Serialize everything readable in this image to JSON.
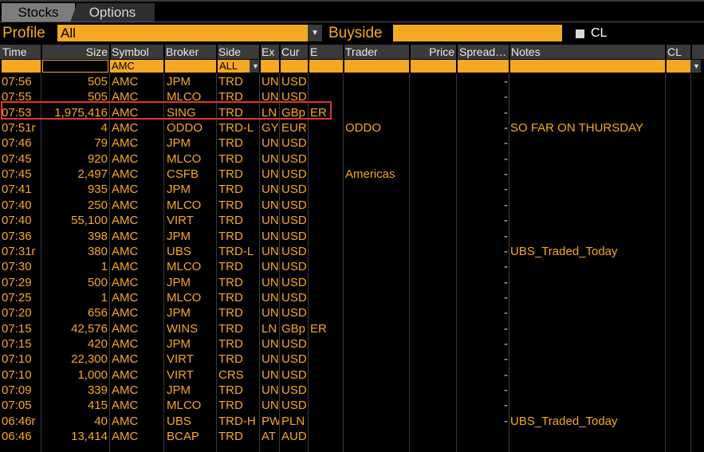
{
  "tabs": [
    {
      "label": "Stocks",
      "active": true
    },
    {
      "label": "Options",
      "active": false
    }
  ],
  "profile": {
    "label": "Profile",
    "value": "All",
    "buyside_label": "Buyside",
    "buyside_value": "",
    "cl_label": "CL",
    "cl_checked": false
  },
  "columns": [
    "Time",
    "Size",
    "Symbol",
    "Broker",
    "Side",
    "Ex",
    "Cur",
    "E",
    "Trader",
    "Price",
    "Spread…",
    "Notes",
    "CL"
  ],
  "filters": {
    "size": "",
    "symbol": "AMC",
    "side": "ALL"
  },
  "colors": {
    "accent": "#f7a823",
    "highlight": "#e0362c",
    "header_bg": "#3a3a3a"
  },
  "rows": [
    {
      "time": "07:56",
      "size": "505",
      "symbol": "AMC",
      "broker": "JPM",
      "side": "TRD",
      "ex": "UN",
      "cur": "USD",
      "e": "",
      "trader": "",
      "spread": "-",
      "notes": ""
    },
    {
      "time": "07:55",
      "size": "505",
      "symbol": "AMC",
      "broker": "MLCO",
      "side": "TRD",
      "ex": "UN",
      "cur": "USD",
      "e": "",
      "trader": "",
      "spread": "-",
      "notes": ""
    },
    {
      "time": "07:53",
      "size": "1,975,416",
      "symbol": "AMC",
      "broker": "SING",
      "side": "TRD",
      "ex": "LN",
      "cur": "GBp",
      "e": "ER",
      "trader": "",
      "spread": "-",
      "notes": ""
    },
    {
      "time": "07:51r",
      "size": "4",
      "symbol": "AMC",
      "broker": "ODDO",
      "side": "TRD-L",
      "ex": "GY",
      "cur": "EUR",
      "e": "",
      "trader": "ODDO",
      "spread": "-",
      "notes": "SO FAR ON THURSDAY"
    },
    {
      "time": "07:46",
      "size": "79",
      "symbol": "AMC",
      "broker": "JPM",
      "side": "TRD",
      "ex": "UN",
      "cur": "USD",
      "e": "",
      "trader": "",
      "spread": "-",
      "notes": ""
    },
    {
      "time": "07:45",
      "size": "920",
      "symbol": "AMC",
      "broker": "MLCO",
      "side": "TRD",
      "ex": "UN",
      "cur": "USD",
      "e": "",
      "trader": "",
      "spread": "-",
      "notes": ""
    },
    {
      "time": "07:45",
      "size": "2,497",
      "symbol": "AMC",
      "broker": "CSFB",
      "side": "TRD",
      "ex": "UN",
      "cur": "USD",
      "e": "",
      "trader": "Americas",
      "spread": "-",
      "notes": ""
    },
    {
      "time": "07:41",
      "size": "935",
      "symbol": "AMC",
      "broker": "JPM",
      "side": "TRD",
      "ex": "UN",
      "cur": "USD",
      "e": "",
      "trader": "",
      "spread": "-",
      "notes": ""
    },
    {
      "time": "07:40",
      "size": "250",
      "symbol": "AMC",
      "broker": "MLCO",
      "side": "TRD",
      "ex": "UN",
      "cur": "USD",
      "e": "",
      "trader": "",
      "spread": "-",
      "notes": ""
    },
    {
      "time": "07:40",
      "size": "55,100",
      "symbol": "AMC",
      "broker": "VIRT",
      "side": "TRD",
      "ex": "UN",
      "cur": "USD",
      "e": "",
      "trader": "",
      "spread": "-",
      "notes": ""
    },
    {
      "time": "07:36",
      "size": "398",
      "symbol": "AMC",
      "broker": "JPM",
      "side": "TRD",
      "ex": "UN",
      "cur": "USD",
      "e": "",
      "trader": "",
      "spread": "-",
      "notes": ""
    },
    {
      "time": "07:31r",
      "size": "380",
      "symbol": "AMC",
      "broker": "UBS",
      "side": "TRD-L",
      "ex": "UN",
      "cur": "USD",
      "e": "",
      "trader": "",
      "spread": "-",
      "notes": "UBS_Traded_Today"
    },
    {
      "time": "07:30",
      "size": "1",
      "symbol": "AMC",
      "broker": "MLCO",
      "side": "TRD",
      "ex": "UN",
      "cur": "USD",
      "e": "",
      "trader": "",
      "spread": "-",
      "notes": ""
    },
    {
      "time": "07:29",
      "size": "500",
      "symbol": "AMC",
      "broker": "JPM",
      "side": "TRD",
      "ex": "UN",
      "cur": "USD",
      "e": "",
      "trader": "",
      "spread": "-",
      "notes": ""
    },
    {
      "time": "07:25",
      "size": "1",
      "symbol": "AMC",
      "broker": "MLCO",
      "side": "TRD",
      "ex": "UN",
      "cur": "USD",
      "e": "",
      "trader": "",
      "spread": "-",
      "notes": ""
    },
    {
      "time": "07:20",
      "size": "656",
      "symbol": "AMC",
      "broker": "JPM",
      "side": "TRD",
      "ex": "UN",
      "cur": "USD",
      "e": "",
      "trader": "",
      "spread": "-",
      "notes": ""
    },
    {
      "time": "07:15",
      "size": "42,576",
      "symbol": "AMC",
      "broker": "WINS",
      "side": "TRD",
      "ex": "LN",
      "cur": "GBp",
      "e": "ER",
      "trader": "",
      "spread": "-",
      "notes": ""
    },
    {
      "time": "07:15",
      "size": "420",
      "symbol": "AMC",
      "broker": "JPM",
      "side": "TRD",
      "ex": "UN",
      "cur": "USD",
      "e": "",
      "trader": "",
      "spread": "-",
      "notes": ""
    },
    {
      "time": "07:10",
      "size": "22,300",
      "symbol": "AMC",
      "broker": "VIRT",
      "side": "TRD",
      "ex": "UN",
      "cur": "USD",
      "e": "",
      "trader": "",
      "spread": "-",
      "notes": ""
    },
    {
      "time": "07:10",
      "size": "1,000",
      "symbol": "AMC",
      "broker": "VIRT",
      "side": "CRS",
      "ex": "UN",
      "cur": "USD",
      "e": "",
      "trader": "",
      "spread": "-",
      "notes": ""
    },
    {
      "time": "07:09",
      "size": "339",
      "symbol": "AMC",
      "broker": "JPM",
      "side": "TRD",
      "ex": "UN",
      "cur": "USD",
      "e": "",
      "trader": "",
      "spread": "-",
      "notes": ""
    },
    {
      "time": "07:05",
      "size": "415",
      "symbol": "AMC",
      "broker": "MLCO",
      "side": "TRD",
      "ex": "UN",
      "cur": "USD",
      "e": "",
      "trader": "",
      "spread": "-",
      "notes": ""
    },
    {
      "time": "06:46r",
      "size": "40",
      "symbol": "AMC",
      "broker": "UBS",
      "side": "TRD-H",
      "ex": "PW",
      "cur": "PLN",
      "e": "",
      "trader": "",
      "spread": "-",
      "notes": "UBS_Traded_Today"
    },
    {
      "time": "06:46",
      "size": "13,414",
      "symbol": "AMC",
      "broker": "BCAP",
      "side": "TRD",
      "ex": "AT",
      "cur": "AUD",
      "e": "",
      "trader": "",
      "spread": "",
      "notes": ""
    }
  ]
}
